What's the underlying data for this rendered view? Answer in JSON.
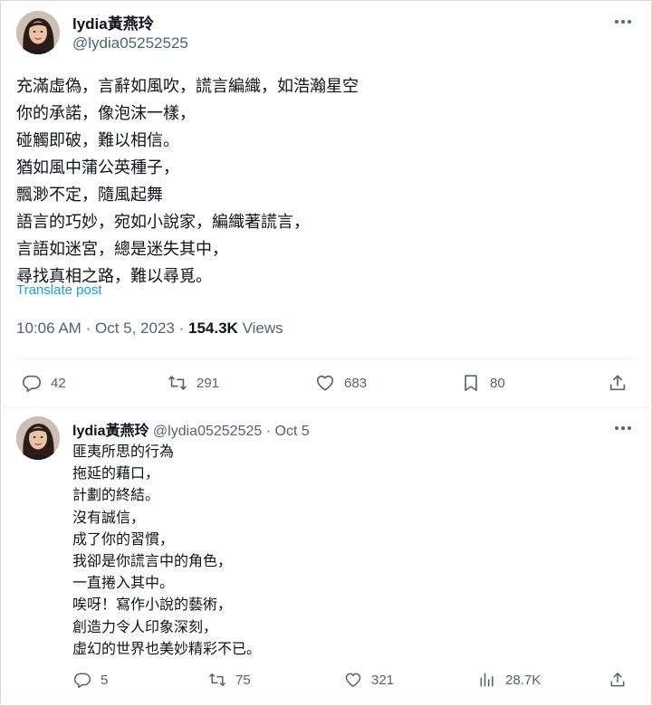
{
  "main_post": {
    "author_name": "lydia黃燕玲",
    "author_handle": "@lydia05252525",
    "body_lines": [
      "充滿虛偽，言辭如風吹，謊言編織，如浩瀚星空",
      "你的承諾，像泡沫一樣，",
      "碰觸即破，難以相信。",
      "猶如風中蒲公英種子，",
      "飄渺不定，隨風起舞",
      "語言的巧妙，宛如小說家，編織著謊言，",
      "言語如迷宮，總是迷失其中，",
      "尋找真相之路，難以尋覓。"
    ],
    "translate_label": "Translate post",
    "time": "10:06 AM",
    "date": "Oct 5, 2023",
    "separator": "·",
    "views_count": "154.3K",
    "views_label": "Views",
    "actions": {
      "replies": "42",
      "reposts": "291",
      "likes": "683",
      "bookmarks": "80"
    }
  },
  "reply_post": {
    "author_name": "lydia黃燕玲",
    "author_handle": "@lydia05252525",
    "separator": "·",
    "date": "Oct 5",
    "body_lines": [
      "匪夷所思的行為",
      "拖延的藉口，",
      "計劃的終結。",
      "沒有誠信，",
      "成了你的習慣，",
      "我卻是你謊言中的角色，",
      "一直捲入其中。",
      "唉呀！寫作小說的藝術，",
      "創造力令人印象深刻，",
      "虛幻的世界也美妙精彩不已。"
    ],
    "actions": {
      "replies": "5",
      "reposts": "75",
      "likes": "321",
      "views": "28.7K"
    }
  },
  "colors": {
    "text": "#0f1419",
    "secondary": "#536471",
    "link": "#1d9bf0",
    "divider": "#eff3f4"
  },
  "icons": [
    "reply-icon",
    "repost-icon",
    "like-icon",
    "bookmark-icon",
    "share-icon",
    "views-icon",
    "more-icon"
  ]
}
